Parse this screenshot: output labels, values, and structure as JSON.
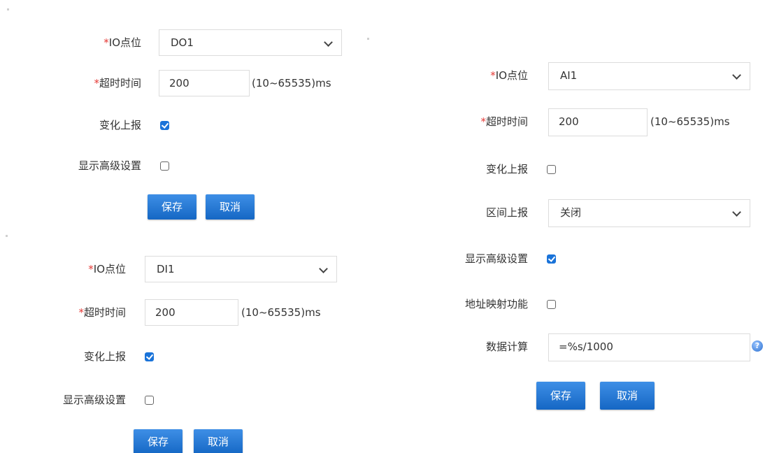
{
  "forms": {
    "do": {
      "io_label": "IO点位",
      "io_value": "DO1",
      "timeout_label": "超时时间",
      "timeout_value": "200",
      "timeout_hint": "(10~65535)ms",
      "report_label": "变化上报",
      "report_checked": true,
      "advanced_label": "显示高级设置",
      "advanced_checked": false,
      "save_label": "保存",
      "cancel_label": "取消"
    },
    "di": {
      "io_label": "IO点位",
      "io_value": "DI1",
      "timeout_label": "超时时间",
      "timeout_value": "200",
      "timeout_hint": "(10~65535)ms",
      "report_label": "变化上报",
      "report_checked": true,
      "advanced_label": "显示高级设置",
      "advanced_checked": false,
      "save_label": "保存",
      "cancel_label": "取消"
    },
    "ai": {
      "io_label": "IO点位",
      "io_value": "AI1",
      "timeout_label": "超时时间",
      "timeout_value": "200",
      "timeout_hint": "(10~65535)ms",
      "report_label": "变化上报",
      "report_checked": false,
      "interval_label": "区间上报",
      "interval_value": "关闭",
      "advanced_label": "显示高级设置",
      "advanced_checked": true,
      "mapping_label": "地址映射功能",
      "mapping_checked": false,
      "calc_label": "数据计算",
      "calc_value": "=%s/1000",
      "save_label": "保存",
      "cancel_label": "取消"
    }
  },
  "required_mark": "*",
  "colors": {
    "primary": "#1a73d9",
    "required": "#e53935"
  }
}
